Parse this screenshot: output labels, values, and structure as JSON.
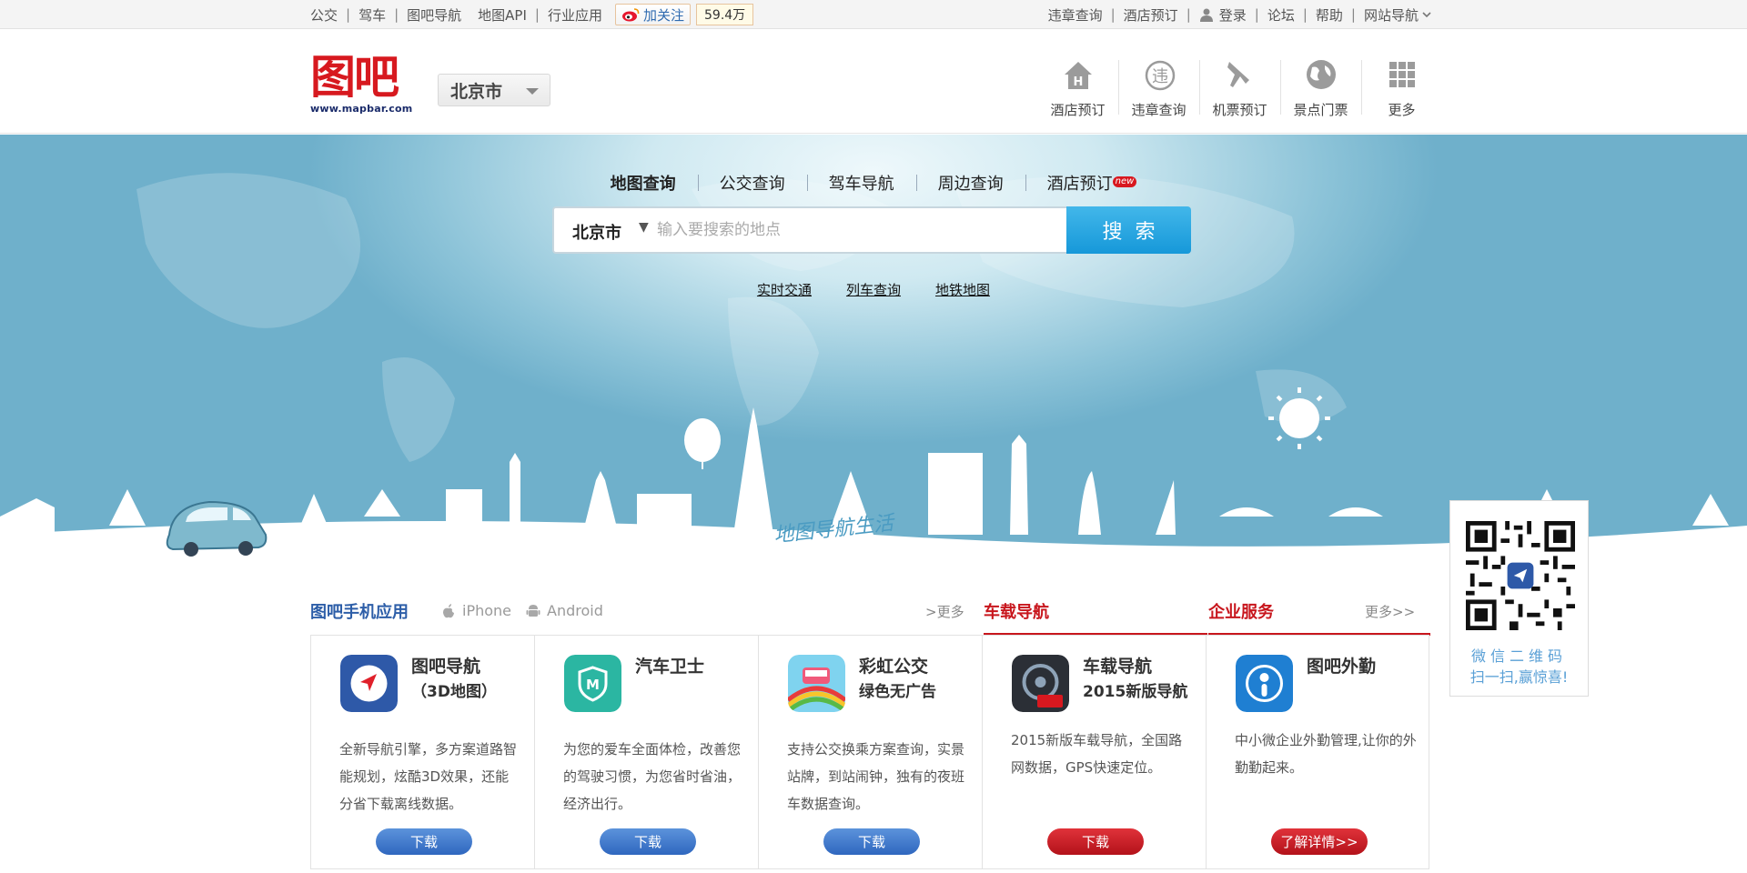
{
  "topbar": {
    "left_links": [
      "公交",
      "驾车",
      "图吧导航",
      "地图API",
      "行业应用"
    ],
    "weibo_follow": "加关注",
    "weibo_count": "59.4万",
    "right_links": [
      "违章查询",
      "酒店预订",
      "登录",
      "论坛",
      "帮助",
      "网站导航"
    ]
  },
  "header": {
    "logo_text": "图吧",
    "logo_url": "www.mapbar.com",
    "city": "北京市",
    "quick_nav": [
      {
        "label": "酒店预订",
        "icon": "hotel-icon"
      },
      {
        "label": "违章查询",
        "icon": "violation-icon"
      },
      {
        "label": "机票预订",
        "icon": "plane-icon"
      },
      {
        "label": "景点门票",
        "icon": "globe-icon"
      },
      {
        "label": "更多",
        "icon": "grid-icon"
      }
    ]
  },
  "hero": {
    "tabs": [
      "地图查询",
      "公交查询",
      "驾车导航",
      "周边查询",
      "酒店预订"
    ],
    "active_tab": "地图查询",
    "new_badge": "new",
    "search_city": "北京市",
    "search_placeholder": "输入要搜索的地点",
    "search_button": "搜索",
    "links": [
      "实时交通",
      "列车查询",
      "地铁地图"
    ],
    "slogan": "地图导航生活"
  },
  "apps": {
    "mobile_title": "图吧手机应用",
    "platform_iphone": "iPhone",
    "platform_android": "Android",
    "mobile_more": ">更多",
    "car_title": "车载导航",
    "enterprise_title": "企业服务",
    "enterprise_more": "更多>>",
    "cards": [
      {
        "name_line1": "图吧导航",
        "name_line2": "（3D地图）",
        "desc": "全新导航引擎，多方案道路智能规划，炫酷3D效果，还能分省下载离线数据。",
        "button": "下载",
        "style": "blue"
      },
      {
        "name_line1": "汽车卫士",
        "name_line2": "",
        "desc": "为您的爱车全面体检，改善您的驾驶习惯，为您省时省油，经济出行。",
        "button": "下载",
        "style": "blue"
      },
      {
        "name_line1": "彩虹公交",
        "name_line2": "绿色无广告",
        "desc": "支持公交换乘方案查询，实景站牌，到站闹钟，独有的夜班车数据查询。",
        "button": "下载",
        "style": "blue"
      },
      {
        "name_line1": "车载导航",
        "name_line2": "2015新版导航",
        "desc": "2015新版车载导航，全国路网数据，GPS快速定位。",
        "button": "下载",
        "style": "red"
      },
      {
        "name_line1": "图吧外勤",
        "name_line2": "",
        "desc": "中小微企业外勤管理,让你的外勤勤起来。",
        "button": "了解详情>>",
        "style": "red"
      }
    ]
  },
  "qr": {
    "line1": "微信二维码",
    "line2": "扫一扫,赢惊喜!"
  },
  "colors": {
    "brand_red": "#c8161d",
    "brand_blue": "#2d5ea8",
    "search_blue": "#1698d9",
    "sky": "#6fb0cb"
  }
}
